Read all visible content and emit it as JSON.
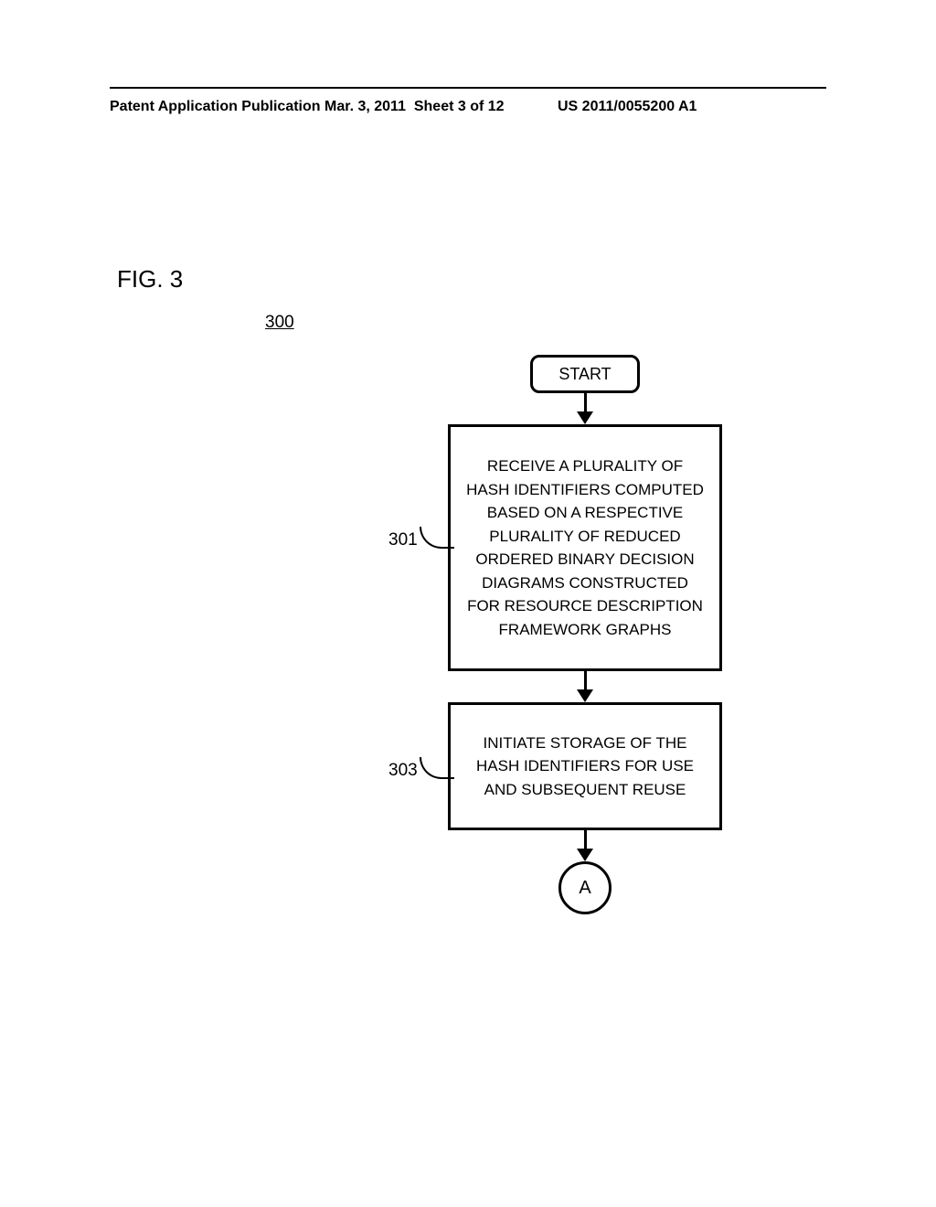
{
  "header": {
    "publication_type": "Patent Application Publication",
    "date": "Mar. 3, 2011",
    "sheet": "Sheet 3 of 12",
    "pub_number": "US 2011/0055200 A1"
  },
  "figure": {
    "label": "FIG. 3",
    "number": "300"
  },
  "flowchart": {
    "start": "START",
    "box_301": {
      "ref": "301",
      "text": "RECEIVE A PLURALITY OF HASH IDENTIFIERS COMPUTED BASED ON A RESPECTIVE PLURALITY OF REDUCED ORDERED BINARY DECISION DIAGRAMS CONSTRUCTED FOR RESOURCE DESCRIPTION FRAMEWORK GRAPHS"
    },
    "box_303": {
      "ref": "303",
      "text": "INITIATE STORAGE OF THE HASH IDENTIFIERS FOR USE AND SUBSEQUENT REUSE"
    },
    "connector": "A"
  }
}
